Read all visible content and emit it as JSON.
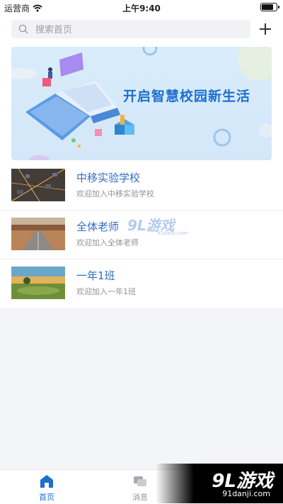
{
  "status_bar": {
    "carrier": "运营商",
    "time": "上午9:40",
    "battery_level": 0.9
  },
  "search": {
    "placeholder": "搜索首页"
  },
  "banner": {
    "title": "开启智慧校园新生活"
  },
  "schools": [
    {
      "name": "中移实验学校",
      "subtitle": "欢迎加入中移实验学校",
      "thumb": "city-aerial-image"
    },
    {
      "name": "全体老师",
      "subtitle": "欢迎加入全体老师",
      "thumb": "desert-road-image"
    },
    {
      "name": "一年1班",
      "subtitle": "欢迎加入一年1班",
      "thumb": "sunset-meadow-image"
    }
  ],
  "watermark": {
    "main": "9L游戏",
    "sub": "91danji.com"
  },
  "tab_bar": {
    "tabs": [
      {
        "label": "首页",
        "icon": "home-icon",
        "active": true
      },
      {
        "label": "消息",
        "icon": "message-icon",
        "active": false
      }
    ]
  },
  "corner_logo": {
    "main": "9L游戏",
    "sub": "91danji.com"
  },
  "colors": {
    "accent": "#2f6fc0",
    "tab_active": "#1e6fd0",
    "tab_inactive": "#8f939a"
  }
}
